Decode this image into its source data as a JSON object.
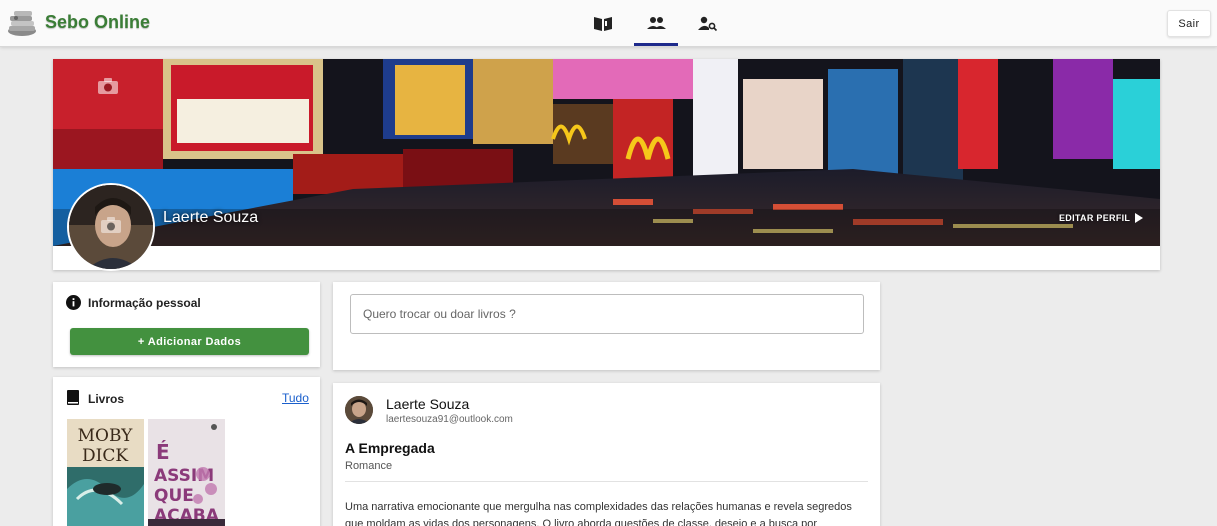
{
  "app": {
    "title": "Sebo Online",
    "logout_label": "Sair"
  },
  "nav": {
    "items": [
      {
        "name": "books",
        "icon": "book-open-icon"
      },
      {
        "name": "friends",
        "icon": "people-icon"
      },
      {
        "name": "find-people",
        "icon": "person-search-icon"
      }
    ],
    "active": "friends"
  },
  "profile": {
    "name": "Laerte Souza",
    "edit_label": "EDITAR PERFIL"
  },
  "personal_info": {
    "title": "Informação pessoal",
    "add_button_label": "+ Adicionar Dados"
  },
  "books": {
    "title": "Livros",
    "all_link": "Tudo"
  },
  "composer": {
    "placeholder": "Quero trocar ou doar livros ?"
  },
  "post": {
    "author": "Laerte Souza",
    "email": "laertesouza91@outlook.com",
    "book_title": "A Empregada",
    "genre": "Romance",
    "description": "Uma narrativa emocionante que mergulha nas complexidades das relações humanas e revela segredos que moldam as vidas dos personagens. O livro aborda questões de classe, desejo e a busca por"
  },
  "colors": {
    "accent_green": "#43913f",
    "nav_active": "#1e2a8c",
    "link": "#1a5fcc"
  }
}
